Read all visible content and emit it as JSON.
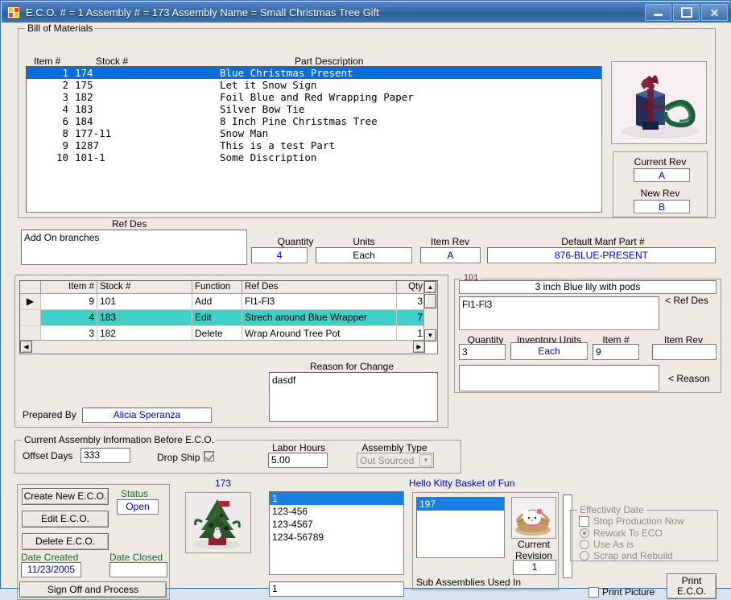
{
  "window": {
    "title": "E.C.O. # = 1 Assembly # = 173 Assembly Name = Small Christmas Tree Gift",
    "icon": "app-grid-icon",
    "minimize": "–",
    "maximize": "□",
    "close": "✕",
    "accent": "#3a6ea8",
    "face": "#eceae3"
  },
  "bom": {
    "group_label": "Bill of Materials",
    "headers": {
      "item": "Item #",
      "stock": "Stock #",
      "desc": "Part Description"
    },
    "rows": [
      {
        "item": "1",
        "stock": "174",
        "desc": "Blue Christmas Present",
        "selected": true
      },
      {
        "item": "2",
        "stock": "175",
        "desc": "Let it Snow Sign",
        "selected": false
      },
      {
        "item": "3",
        "stock": "182",
        "desc": "Foil Blue and Red Wrapping Paper",
        "selected": false
      },
      {
        "item": "4",
        "stock": "183",
        "desc": "Silver Bow Tie",
        "selected": false
      },
      {
        "item": "6",
        "stock": "184",
        "desc": "8 Inch Pine Christmas Tree",
        "selected": false
      },
      {
        "item": "8",
        "stock": "177-11",
        "desc": "Snow Man",
        "selected": false
      },
      {
        "item": "9",
        "stock": "1287",
        "desc": "This is a test Part",
        "selected": false
      },
      {
        "item": "10",
        "stock": "101-1",
        "desc": "Some Discription",
        "selected": false
      }
    ]
  },
  "revision": {
    "current_rev_label": "Current Rev",
    "current_rev_value": "A",
    "new_rev_label": "New Rev",
    "new_rev_value": "B"
  },
  "part_detail": {
    "ref_des_label": "Ref Des",
    "ref_des_value": "Add On branches",
    "quantity_label": "Quantity",
    "quantity_value": "4",
    "units_label": "Units",
    "units_value": "Each",
    "item_rev_label": "Item Rev",
    "item_rev_value": "A",
    "manf_label": "Default Manf Part #",
    "manf_value": "876-BLUE-PRESENT"
  },
  "changegrid": {
    "headers": {
      "mark": "",
      "item": "Item #",
      "stock": "Stock #",
      "function": "Function",
      "refdes": "Ref Des",
      "qty": "Qty"
    },
    "rows": [
      {
        "mark": "▶",
        "item": "9",
        "stock": "101",
        "function": "Add",
        "refdes": "Fl1-Fl3",
        "qty": "3",
        "selected": false
      },
      {
        "mark": "",
        "item": "4",
        "stock": "183",
        "function": "Edit",
        "refdes": "Strech around Blue Wrapper",
        "qty": "7",
        "selected": true
      },
      {
        "mark": "",
        "item": "3",
        "stock": "182",
        "function": "Delete",
        "refdes": "Wrap Around Tree Pot",
        "qty": "1",
        "selected": false
      }
    ],
    "scroll_up": "▲",
    "scroll_down": "▼",
    "scroll_left": "◀",
    "scroll_right": "▶"
  },
  "line_detail": {
    "group_label": "101",
    "description": "3 inch Blue lily with pods",
    "refdes_value": "Fl1-Fl3",
    "refdes_caption": "< Ref Des",
    "quantity_label": "Quantity",
    "quantity_value": "3",
    "inventory_units_label": "Inventory Units",
    "inventory_units_value": "Each",
    "item_label": "Item #",
    "item_value": "9",
    "item_rev_label": "Item Rev",
    "item_rev_value": "",
    "reason_value": "",
    "reason_caption": "< Reason"
  },
  "reason": {
    "label": "Reason for Change",
    "value": "dasdf"
  },
  "prepared": {
    "label": "Prepared By",
    "value": "Alicia Speranza"
  },
  "assembly_info": {
    "group_label": "Current Assembly Information Before E.C.O.",
    "offset_days_label": "Offset Days",
    "offset_days_value": "333",
    "drop_ship_label": "Drop Ship",
    "drop_ship_checked": true,
    "labor_hours_label": "Labor Hours",
    "labor_hours_value": "5.00",
    "assembly_type_label": "Assembly Type",
    "assembly_type_value": "Out Sourced"
  },
  "actions": {
    "create": "Create New E.C.O.",
    "edit": "Edit E.C.O.",
    "delete": "Delete E.C.O.",
    "sign_off": "Sign Off and Process",
    "status_label": "Status",
    "status_value": "Open",
    "date_created_label": "Date Created",
    "date_created_value": "11/23/2005",
    "date_closed_label": "Date Closed",
    "date_closed_value": ""
  },
  "assembly_preview": {
    "number": "173",
    "image": "christmas-tree-photo"
  },
  "rev_list": {
    "items": [
      {
        "text": "1",
        "selected": true
      },
      {
        "text": "123-456",
        "selected": false
      },
      {
        "text": "123-4567",
        "selected": false
      },
      {
        "text": "1234-56789",
        "selected": false
      }
    ],
    "selected_value": "1"
  },
  "sub_assemblies": {
    "title": "Hello Kitty Basket of Fun",
    "items": [
      {
        "text": "197",
        "selected": true
      }
    ],
    "current_revision_label": "Current\nRevision",
    "current_revision_line1": "Current",
    "current_revision_line2": "Revision",
    "current_revision_value": "1",
    "caption": "Sub Assemblies Used In",
    "image": "hello-kitty-basket-photo"
  },
  "effectivity": {
    "group_label": "Effectivity Date",
    "stop_production_label": "Stop Production Now",
    "stop_production_checked": false,
    "options": [
      {
        "label": "Rework To ECO",
        "selected": true
      },
      {
        "label": "Use As is",
        "selected": false
      },
      {
        "label": "Scrap and Rebuild",
        "selected": false
      }
    ]
  },
  "print": {
    "print_picture_label": "Print Picture",
    "print_picture_checked": false,
    "print_button_line1": "Print",
    "print_button_line2": "E.C.O."
  }
}
